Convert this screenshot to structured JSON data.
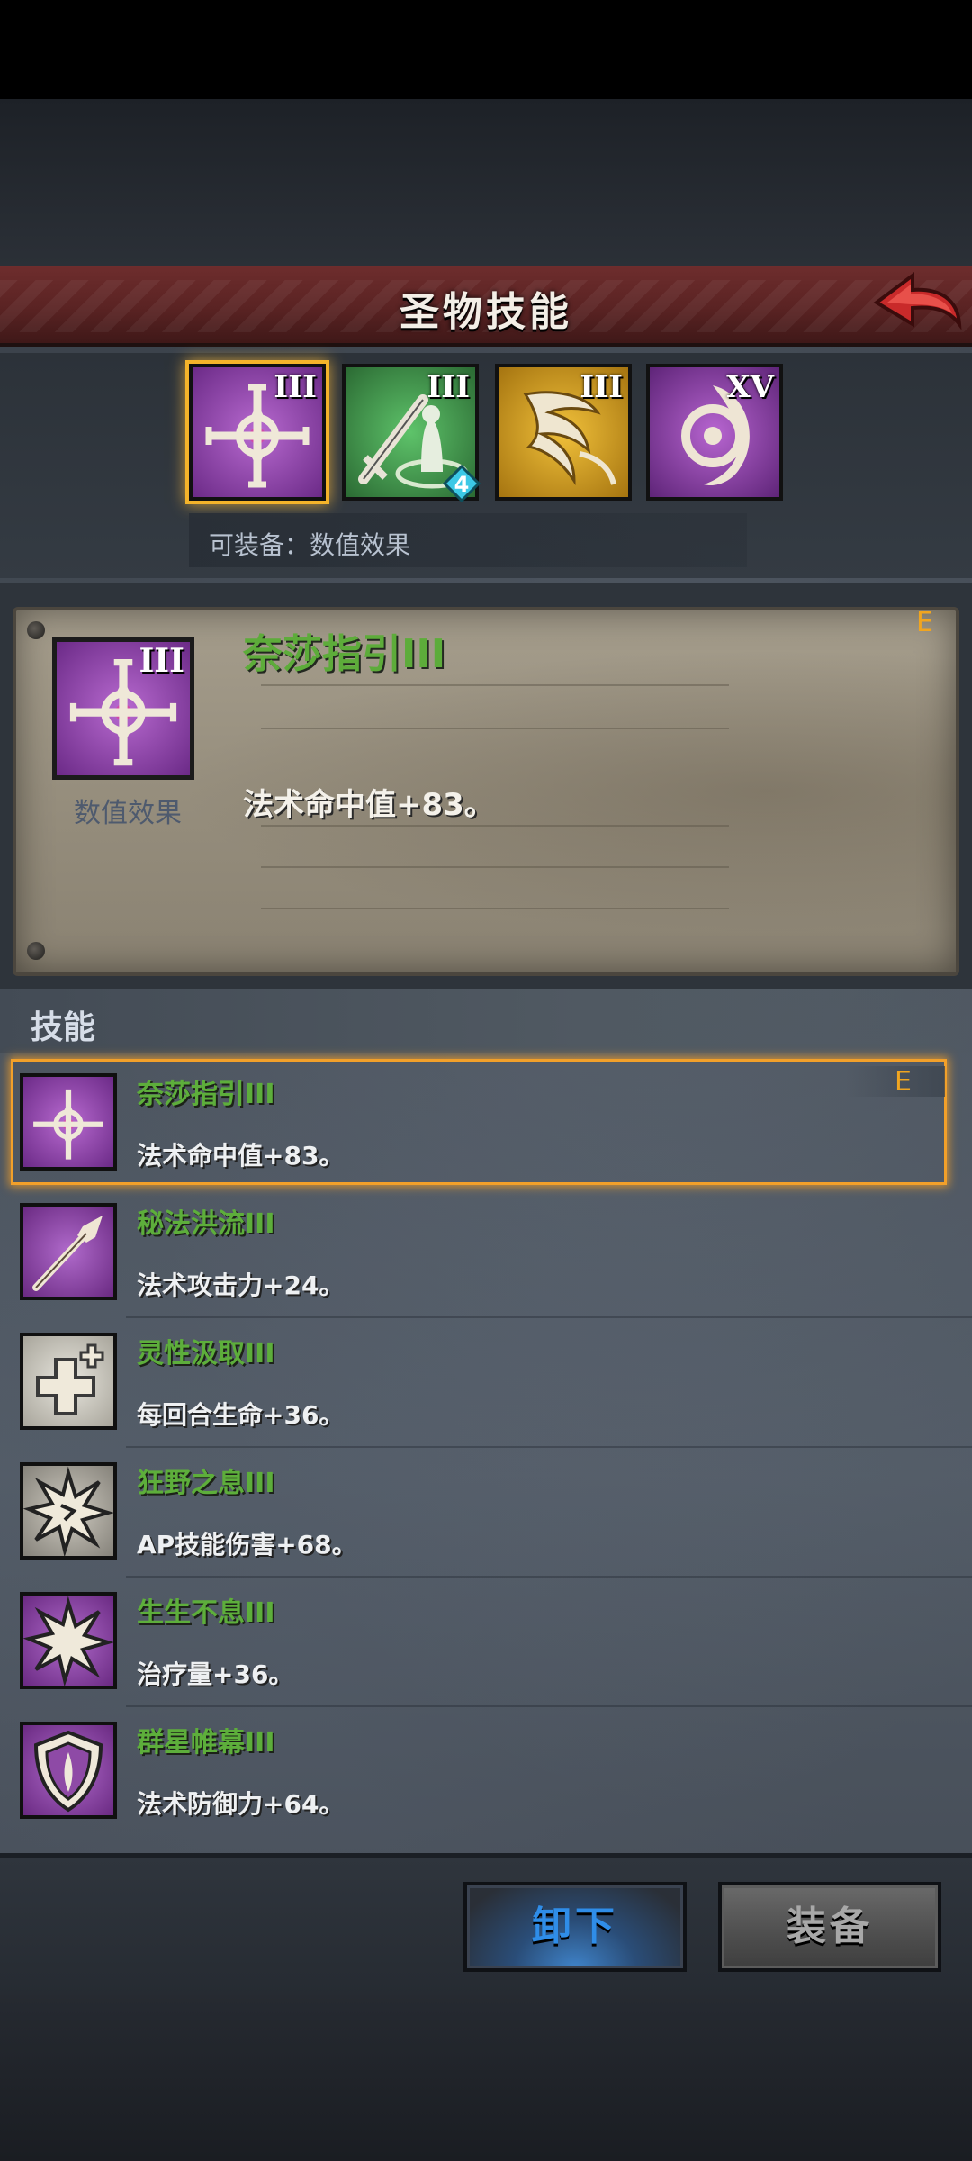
{
  "header": {
    "title": "圣物技能"
  },
  "relics": [
    {
      "roman": "III",
      "icon": "compass-cross-icon",
      "color": "#8b3aa8",
      "selected": true
    },
    {
      "roman": "III",
      "icon": "sword-statue-icon",
      "color": "#3f8a45",
      "badge": "4"
    },
    {
      "roman": "III",
      "icon": "phoenix-icon",
      "color": "#c79618"
    },
    {
      "roman": "XV",
      "icon": "swirl-orb-icon",
      "color": "#7d3c97"
    }
  ],
  "equip_hint": "可装备：数值效果",
  "detail": {
    "roman": "III",
    "type_label": "数值效果",
    "name": "奈莎指引III",
    "grade": "E",
    "effect": "法术命中值+83。"
  },
  "skills_title": "技能",
  "skills": [
    {
      "name": "奈莎指引III",
      "effect": "法术命中值+83。",
      "icon": "compass-cross-icon",
      "grade": "E"
    },
    {
      "name": "秘法洪流III",
      "effect": "法术攻击力+24。",
      "icon": "spear-icon"
    },
    {
      "name": "灵性汲取III",
      "effect": "每回合生命+36。",
      "icon": "health-cross-icon"
    },
    {
      "name": "狂野之息III",
      "effect": "AP技能伤害+68。",
      "icon": "burst-icon"
    },
    {
      "name": "生生不息III",
      "effect": "治疗量+36。",
      "icon": "burst-icon"
    },
    {
      "name": "群星帷幕III",
      "effect": "法术防御力+64。",
      "icon": "shield-icon"
    }
  ],
  "buttons": {
    "unequip": "卸下",
    "equip": "装备"
  }
}
